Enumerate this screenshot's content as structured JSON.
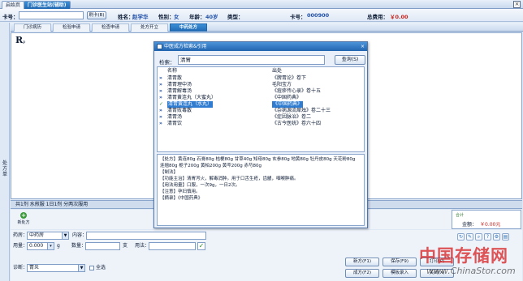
{
  "tabbar": {
    "tabs": [
      {
        "label": "启始页",
        "active": false
      },
      {
        "label": "门诊医生站(辅助)",
        "active": true
      }
    ],
    "close_glyph": "×"
  },
  "patient": {
    "card_label": "卡号：",
    "read_card_button": "刷卡(B)",
    "name_label": "姓名：",
    "name_value": "赵学华",
    "gender_label": "性别：",
    "gender_value": "女",
    "age_label": "年龄：",
    "age_value": "40岁",
    "type_label": "类型：",
    "card_no_label": "卡号：",
    "card_no_value": "000900",
    "total_label": "总费用：",
    "total_value": "￥0.00"
  },
  "leftstrip": {
    "text": "处方单"
  },
  "subtabs": [
    {
      "label": "门诊病历",
      "active": false
    },
    {
      "label": "检验申请",
      "active": false
    },
    {
      "label": "检查申请",
      "active": false
    },
    {
      "label": "处方开立",
      "active": false
    },
    {
      "label": "中药处方",
      "active": true
    }
  ],
  "prescription": {
    "r_symbol": "R",
    "r_sub": "p",
    "summary": "共1剂  水煎服  1日1剂  分两次服用",
    "new_button": "新处方",
    "total_title": "合计",
    "total_label": "金额：",
    "total_value": "￥0.00元"
  },
  "form": {
    "pharmacy_label": "药房：",
    "pharmacy_value": "中药房",
    "content_label": "内容：",
    "dose_label": "用量：",
    "dose_value": "0.000",
    "dose_unit": "g",
    "qty_label": "数量：",
    "qty_unit": "支",
    "usage_label": "用法：",
    "diag_label": "诊断：",
    "diag_value": "胃炎",
    "select_all_label": "全选",
    "buttons": {
      "new_rx": "新方(F1)",
      "save": "保存(F9)",
      "print": "打印(P)",
      "formula": "成方(F2)",
      "template": "模板录入",
      "close": "关闭(X)"
    },
    "tool_icons": [
      "refresh-icon",
      "edit-icon",
      "search-icon",
      "help-icon",
      "settings-icon",
      "print-icon"
    ]
  },
  "dialog": {
    "title": "中医成方检索&引用",
    "close_glyph": "×",
    "search_label": "检索：",
    "search_value": "清胃",
    "search_button": "查询(S)",
    "col_name": "名称",
    "col_source": "出处",
    "rows": [
      {
        "name": "清胃散",
        "source": "《脾胃论》卷下",
        "selected": false
      },
      {
        "name": "清胃理中汤",
        "source": "毛阳宝方",
        "selected": false
      },
      {
        "name": "清胃解毒汤",
        "source": "《痘疹传心录》卷十五",
        "selected": false
      },
      {
        "name": "清胃黄连丸（大蜜丸）",
        "source": "《中国药典》",
        "selected": false
      },
      {
        "name": "清胃黄连丸（水丸）",
        "source": "《中国药典》",
        "selected": true
      },
      {
        "name": "清胃败毒散",
        "source": "《杂病源流犀烛》卷二十三",
        "selected": false
      },
      {
        "name": "清胃汤",
        "source": "《症因脉治》卷二",
        "selected": false
      },
      {
        "name": "清胃饮",
        "source": "《古今医统》卷六十四",
        "selected": false
      }
    ],
    "detail": [
      "【处方】黄连80g  石膏80g  桔梗80g  甘草40g  知母80g  玄参80g  地黄80g  牡丹皮80g  天花粉80g",
      "连翘80g  栀子200g  黄柏200g  黄芩200g  赤芍80g",
      "【制法】",
      "【功能主治】清胃泻火，解毒消肿。用于口舌生疮，齿龈，咽喉肿痛。",
      "【用法用量】口服，一次9g，一日2次。",
      "【注意】孕妇慎用。",
      "【摘录】《中国药典》"
    ]
  },
  "watermark": {
    "line1": "中国存储网",
    "line2": "www.ChinaStor.com"
  }
}
